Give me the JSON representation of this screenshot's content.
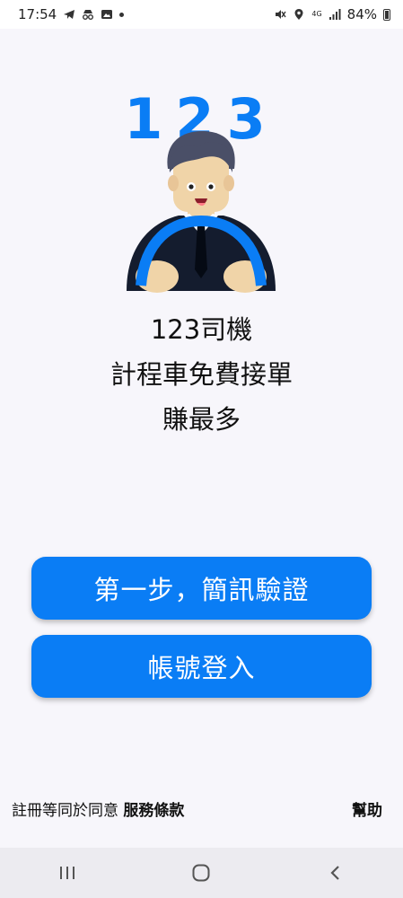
{
  "status_bar": {
    "time": "17:54",
    "battery": "84%",
    "network": "4G"
  },
  "hero": {
    "numbers": "123",
    "accent_color": "#0a7df5"
  },
  "headline": {
    "line1": "123司機",
    "line2": "計程車免費接單",
    "line3": "賺最多"
  },
  "buttons": {
    "sms_verify": "第一步，簡訊驗證",
    "account_login": "帳號登入"
  },
  "footer": {
    "agree_text": "註冊等同於同意",
    "terms_link": "服務條款",
    "help_link": "幫助"
  },
  "nav": {
    "recent_icon": "recent-apps-icon",
    "home_icon": "home-icon",
    "back_icon": "back-icon"
  }
}
